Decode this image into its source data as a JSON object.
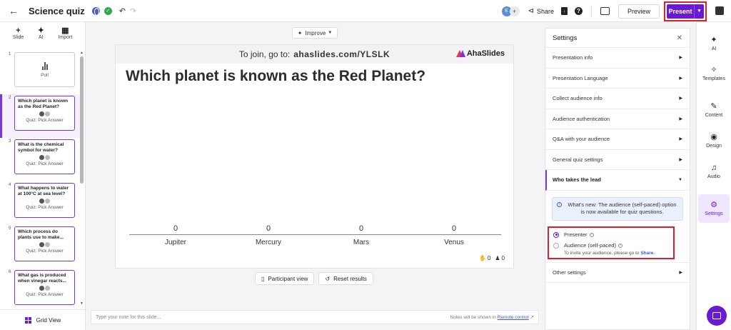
{
  "header": {
    "title": "Science quiz",
    "avatar_initial": "E",
    "share_label": "Share",
    "preview_label": "Preview",
    "present_label": "Present"
  },
  "left_panel": {
    "add_actions": [
      {
        "icon": "plus-icon",
        "label": "Slide"
      },
      {
        "icon": "ai-sparkle-icon",
        "label": "AI"
      },
      {
        "icon": "import-icon",
        "label": "Import"
      }
    ],
    "slides": [
      {
        "number": "1",
        "kind": "poll",
        "label": "Poll"
      },
      {
        "number": "2",
        "kind": "quiz",
        "question": "Which planet is known as the Red Planet?",
        "type": "Quiz: Pick Answer",
        "active": true
      },
      {
        "number": "3",
        "kind": "quiz",
        "question": "What is the chemical symbol for water?",
        "type": "Quiz: Pick Answer"
      },
      {
        "number": "4",
        "kind": "quiz",
        "question": "What happens to water at 100°C at sea level?",
        "type": "Quiz: Pick Answer"
      },
      {
        "number": "5",
        "kind": "quiz",
        "question": "Which process do plants use to make...",
        "type": "Quiz: Pick Answer"
      },
      {
        "number": "6",
        "kind": "quiz",
        "question": "What gas is produced when vinegar reacts...",
        "type": "Quiz: Pick Answer"
      }
    ],
    "grid_view_label": "Grid View"
  },
  "canvas": {
    "improve_label": "Improve",
    "join_text": "To join, go to:",
    "join_url": "ahaslides.com/YLSLK",
    "logo_text": "AhaSlides",
    "question": "Which planet is known as the Red Planet?",
    "options": [
      {
        "name": "Jupiter",
        "count": "0"
      },
      {
        "name": "Mercury",
        "count": "0"
      },
      {
        "name": "Mars",
        "count": "0"
      },
      {
        "name": "Venus",
        "count": "0"
      }
    ],
    "reactions_count": "0",
    "participants_count": "0",
    "participant_view_label": "Participant view",
    "reset_results_label": "Reset results"
  },
  "notes": {
    "placeholder": "Type your note for this slide...",
    "hint_prefix": "Notes will be shown in",
    "hint_link": "Remote control"
  },
  "settings": {
    "title": "Settings",
    "items": [
      "Presentation info",
      "Presentation Language",
      "Collect audience info",
      "Audience authentication",
      "Q&A with your audience",
      "General quiz settings"
    ],
    "expanded_section": "Who takes the lead",
    "info_text": "What's new: The audience (self-paced) option is now available for quiz questions.",
    "radio_options": [
      {
        "label": "Presenter",
        "selected": true
      },
      {
        "label": "Audience (self-paced)",
        "selected": false
      }
    ],
    "invite_hint": "To invite your audience, please go to",
    "invite_link": "Share.",
    "other_settings": "Other settings"
  },
  "right_rail": [
    {
      "icon": "ai-sparkle-icon",
      "label": "AI"
    },
    {
      "icon": "templates-icon",
      "label": "Templates"
    },
    {
      "icon": "pencil-icon",
      "label": "Content"
    },
    {
      "icon": "palette-icon",
      "label": "Design"
    },
    {
      "icon": "music-note-icon",
      "label": "Audio"
    },
    {
      "icon": "gear-icon",
      "label": "Settings",
      "active": true
    }
  ],
  "colors": {
    "brand_purple": "#6a1bd1",
    "highlight_red": "#d8202a",
    "info_blue": "#eaf1fc"
  }
}
